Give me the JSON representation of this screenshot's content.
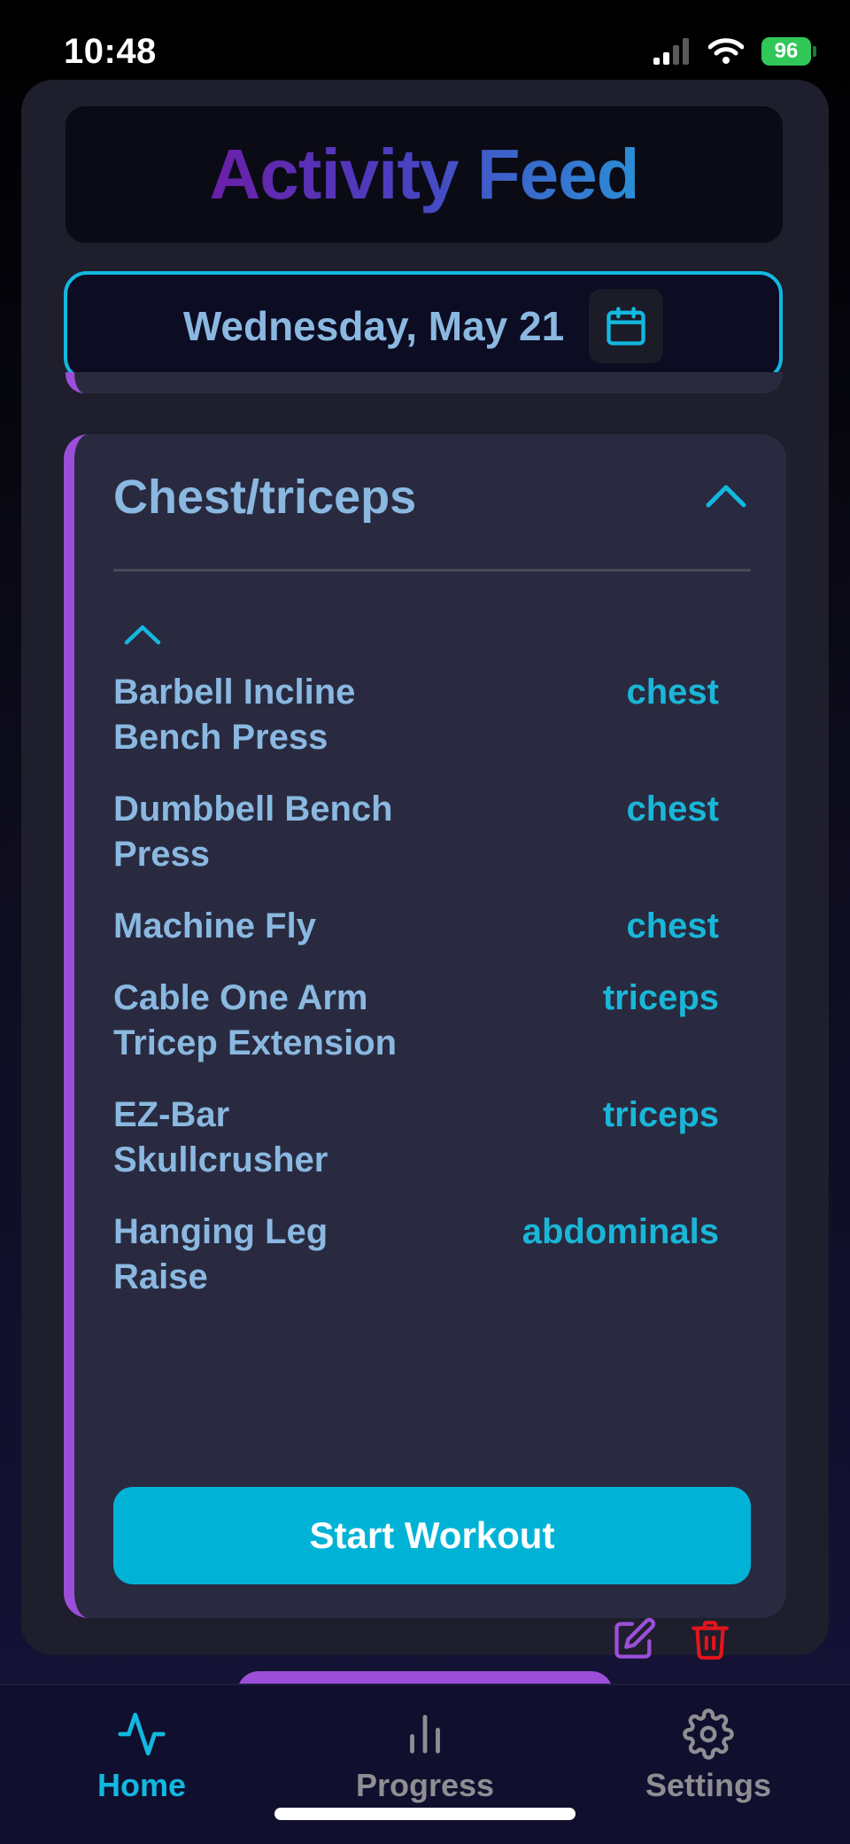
{
  "status_bar": {
    "time": "10:48",
    "battery": "96",
    "signal_icon": "cellular-signal-icon",
    "wifi_icon": "wifi-icon"
  },
  "header": {
    "title": "Activity Feed"
  },
  "date_selector": {
    "label": "Wednesday, May 21",
    "icon": "calendar-icon"
  },
  "workout": {
    "title": "Chest/triceps",
    "exercises": [
      {
        "name": "Barbell Incline Bench Press",
        "muscle": "chest"
      },
      {
        "name": "Dumbbell Bench Press",
        "muscle": "chest"
      },
      {
        "name": "Machine Fly",
        "muscle": "chest"
      },
      {
        "name": "Cable One Arm Tricep Extension",
        "muscle": "triceps"
      },
      {
        "name": "EZ-Bar Skullcrusher",
        "muscle": "triceps"
      },
      {
        "name": "Hanging Leg Raise",
        "muscle": "abdominals"
      }
    ],
    "start_label": "Start Workout",
    "accent_color": "#9b4fd9"
  },
  "tab_bar": {
    "tabs": [
      {
        "label": "Home",
        "icon": "activity-pulse-icon",
        "active": true
      },
      {
        "label": "Progress",
        "icon": "bar-chart-icon",
        "active": false
      },
      {
        "label": "Settings",
        "icon": "gear-icon",
        "active": false
      }
    ],
    "active_color": "#12b8e0",
    "inactive_color": "#8e8e93"
  }
}
